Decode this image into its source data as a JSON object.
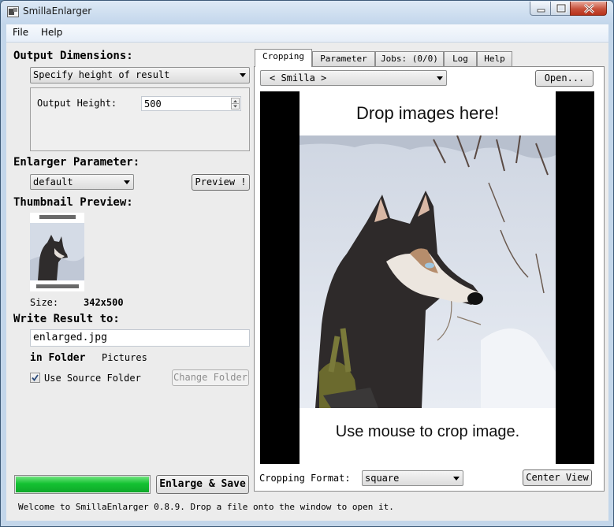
{
  "window": {
    "title": "SmillaEnlarger"
  },
  "menu": {
    "items": [
      "File",
      "Help"
    ]
  },
  "left": {
    "output_dimensions": {
      "heading": "Output Dimensions:",
      "mode": "Specify height of result",
      "field_label": "Output Height:",
      "field_value": "500"
    },
    "enlarger_parameter": {
      "heading": "Enlarger Parameter:",
      "preset": "default",
      "preview_button": "Preview !"
    },
    "thumbnail": {
      "heading": "Thumbnail Preview:",
      "size_label": "Size:",
      "size_value": "342x500"
    },
    "write_result": {
      "heading": "Write Result to:",
      "filename": "enlarged.jpg",
      "in_folder_label": "in Folder",
      "folder": "Pictures",
      "use_source_label": "Use Source Folder",
      "use_source_checked": true,
      "change_folder_button": "Change Folder"
    },
    "progress": 1.0,
    "enlarge_button": "Enlarge & Save"
  },
  "tabs": [
    {
      "label": "Cropping",
      "active": true
    },
    {
      "label": "Parameter",
      "active": false
    },
    {
      "label": "Jobs: (0/0)",
      "active": false
    },
    {
      "label": "Log",
      "active": false
    },
    {
      "label": "Help",
      "active": false
    }
  ],
  "cropping": {
    "source_selector": "< Smilla >",
    "open_button": "Open...",
    "image_top_text": "Drop images here!",
    "image_bottom_text": "Use mouse to crop image.",
    "format_label": "Cropping Format:",
    "format_value": "square",
    "center_view_button": "Center View"
  },
  "status_bar": "Welcome to SmillaEnlarger 0.8.9.  Drop a file onto the window to open it.",
  "colors": {
    "progress_green": "#1ecb3a",
    "accent": "#3c7fb1"
  }
}
